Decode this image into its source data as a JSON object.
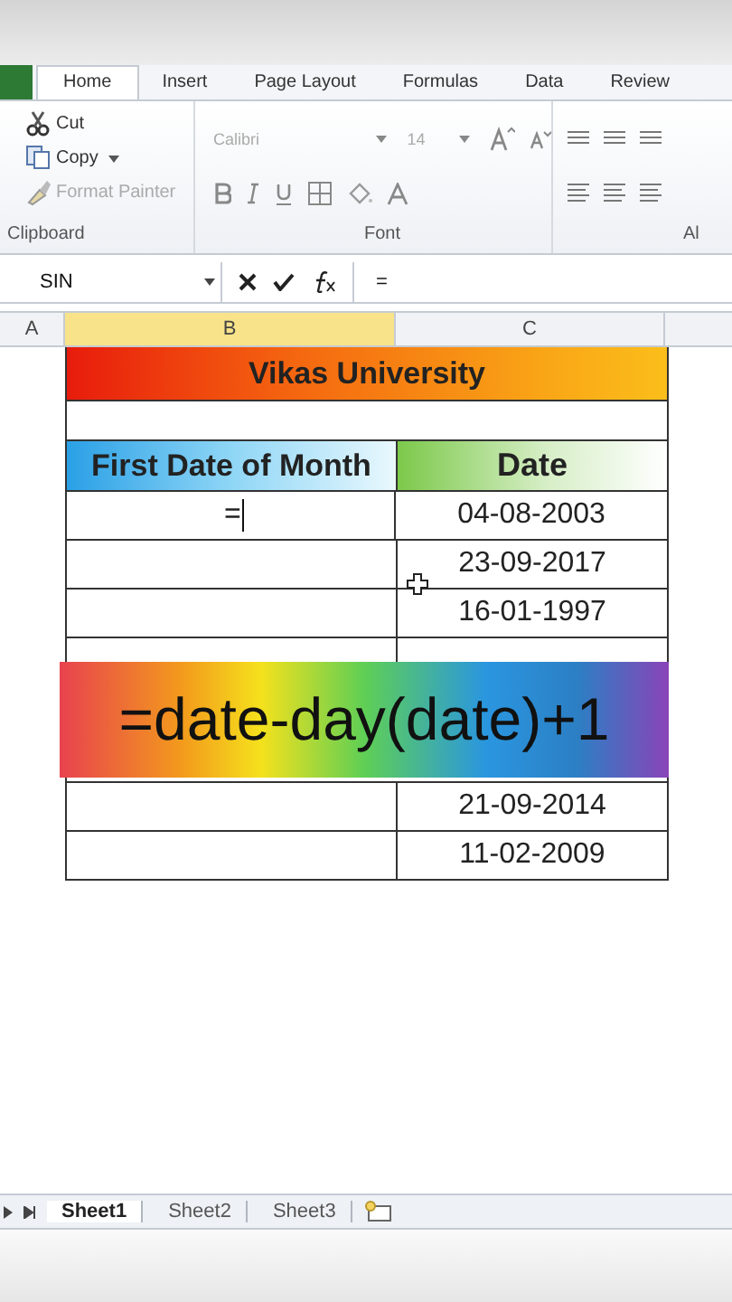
{
  "ribbon_tabs": [
    {
      "label": "Home",
      "selected": true
    },
    {
      "label": "Insert",
      "selected": false
    },
    {
      "label": "Page Layout",
      "selected": false
    },
    {
      "label": "Formulas",
      "selected": false
    },
    {
      "label": "Data",
      "selected": false
    },
    {
      "label": "Review",
      "selected": false
    }
  ],
  "clipboard": {
    "label": "Clipboard",
    "commands": [
      {
        "label": "Cut",
        "disabled": false
      },
      {
        "label": "Copy",
        "disabled": false
      },
      {
        "label": "Format Painter",
        "disabled": true
      }
    ]
  },
  "font": {
    "label": "Font",
    "name": "Calibri",
    "size": "14",
    "disabled": true
  },
  "alignment": {
    "label": "Al"
  },
  "formula_bar": {
    "name_box": "SIN",
    "formula": "="
  },
  "columns": [
    {
      "label": "A",
      "selected": false
    },
    {
      "label": "B",
      "selected": true
    },
    {
      "label": "C",
      "selected": false
    }
  ],
  "sheet": {
    "title": "Vikas University",
    "headers": [
      "First Date of Month",
      "Date"
    ],
    "rows": [
      {
        "first_date": "=",
        "date": "04-08-2003",
        "editing": true
      },
      {
        "date": "23-09-2017",
        "editing": false
      },
      {
        "date": "16-01-1997",
        "editing": false
      },
      {
        "editing": false
      }
    ],
    "rows_after": [
      {
        "date": "21-09-2014",
        "editing": false
      },
      {
        "date": "11-02-2009",
        "editing": false
      }
    ]
  },
  "overlay": {
    "text": "=date-day(date)+1"
  },
  "sheet_tabs": [
    {
      "label": "Sheet1",
      "selected": true
    },
    {
      "label": "Sheet2",
      "selected": false
    },
    {
      "label": "Sheet3",
      "selected": false
    }
  ]
}
